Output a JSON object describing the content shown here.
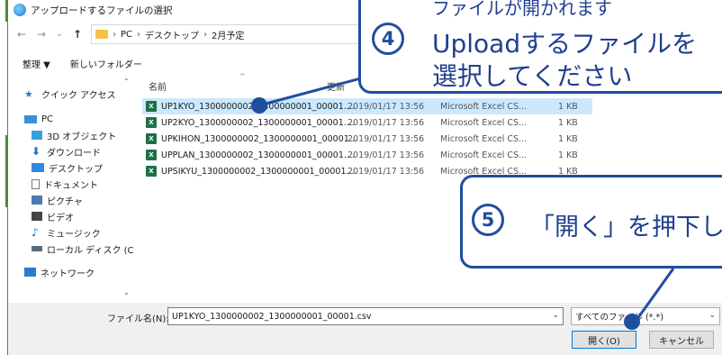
{
  "title": "アップロードするファイルの選択",
  "nav": {
    "back": "←",
    "forward": "→",
    "recent": "⌄",
    "up": "↑"
  },
  "breadcrumb": {
    "sep": "›",
    "items": [
      "PC",
      "デスクトップ",
      "2月予定"
    ]
  },
  "toolbar": {
    "organize": "整理 ▼",
    "new_folder": "新しいフォルダー"
  },
  "navpane": {
    "items": [
      {
        "label": "クイック アクセス",
        "icon": "star-icon",
        "color": "#2b7bd1"
      },
      {
        "label": "PC",
        "icon": "monitor-icon",
        "color": "#3b8fd8"
      },
      {
        "label": "3D オブジェクト",
        "icon": "cube-icon",
        "color": "#3aa0d8"
      },
      {
        "label": "ダウンロード",
        "icon": "download-icon",
        "color": "#2b72c8"
      },
      {
        "label": "デスクトップ",
        "icon": "desktop-icon",
        "color": "#2f8ae0"
      },
      {
        "label": "ドキュメント",
        "icon": "document-icon",
        "color": "#6c7a8a"
      },
      {
        "label": "ピクチャ",
        "icon": "picture-icon",
        "color": "#4a7bb0"
      },
      {
        "label": "ビデオ",
        "icon": "video-icon",
        "color": "#444"
      },
      {
        "label": "ミュージック",
        "icon": "music-icon",
        "color": "#1a73d0"
      },
      {
        "label": "ローカル ディスク (C",
        "icon": "disk-icon",
        "color": "#5a6d7a"
      },
      {
        "label": "ネットワーク",
        "icon": "network-icon",
        "color": "#2b7bd1"
      }
    ]
  },
  "columns": {
    "name": "名前",
    "modified": "更新"
  },
  "files": [
    {
      "name": "UP1KYO_1300000002_1300000001_00001....",
      "date": "2019/01/17 13:56",
      "type": "Microsoft Excel CS...",
      "size": "1 KB",
      "selected": true
    },
    {
      "name": "UP2KYO_1300000002_1300000001_00001....",
      "date": "2019/01/17 13:56",
      "type": "Microsoft Excel CS...",
      "size": "1 KB",
      "selected": false
    },
    {
      "name": "UPKIHON_1300000002_1300000001_00001...",
      "date": "2019/01/17 13:56",
      "type": "Microsoft Excel CS...",
      "size": "1 KB",
      "selected": false
    },
    {
      "name": "UPPLAN_1300000002_1300000001_00001....",
      "date": "2019/01/17 13:56",
      "type": "Microsoft Excel CS...",
      "size": "1 KB",
      "selected": false
    },
    {
      "name": "UPSIKYU_1300000002_1300000001_00001....",
      "date": "2019/01/17 13:56",
      "type": "Microsoft Excel CS...",
      "size": "1 KB",
      "selected": false
    }
  ],
  "filename": {
    "label": "ファイル名(N):",
    "value": "UP1KYO_1300000002_1300000001_00001.csv"
  },
  "filetype": {
    "value": "すべてのファイル (*.*)"
  },
  "buttons": {
    "open": "開く(O)",
    "cancel": "キャンセル"
  },
  "callouts": {
    "step4": {
      "number": "4",
      "line1": "ファイルが開かれます",
      "line2": "Uploadするファイルを",
      "line3": "選択してください"
    },
    "step5": {
      "number": "5",
      "text": "「開く」を押下し"
    }
  },
  "colors": {
    "accent": "#1f4e9e",
    "selected_row": "#cce8ff"
  }
}
